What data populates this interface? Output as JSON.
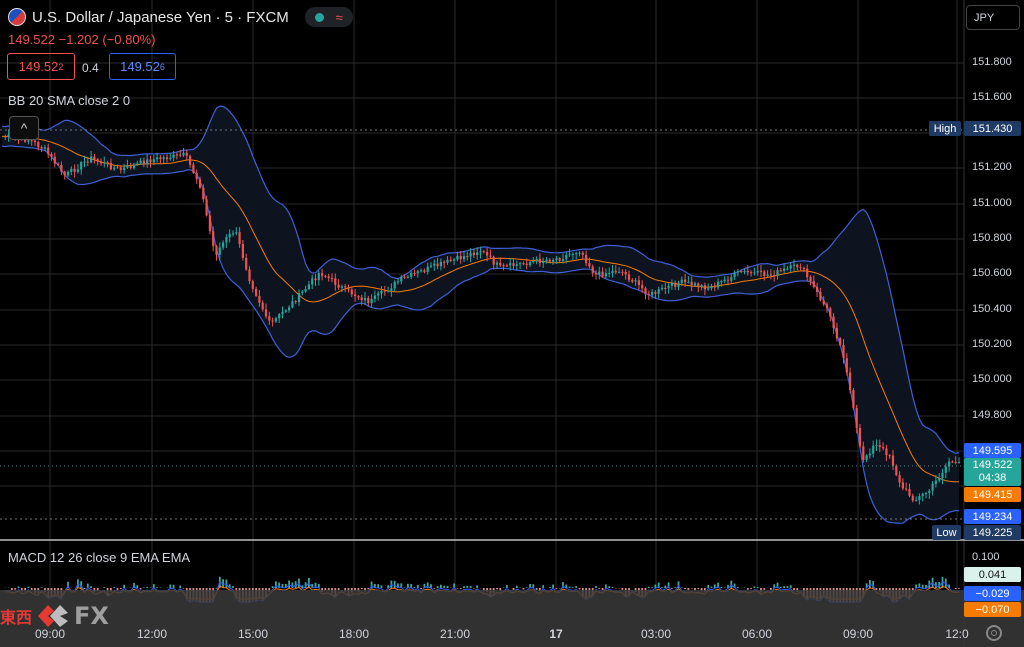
{
  "header": {
    "symbol": "U.S. Dollar / Japanese Yen · 5 · FXCM",
    "wave_icon": "≈"
  },
  "quote": {
    "last": "149.522",
    "change": "−1.202",
    "change_pct": "(−0.80%)",
    "sell": "149.52",
    "sell_sup": "2",
    "spread": "0.4",
    "buy": "149.52",
    "buy_sup": "6"
  },
  "indicators": {
    "bb_label": "BB 20 SMA close 2 0",
    "macd_label": "MACD 12 26 close 9 EMA EMA"
  },
  "toolbar": {
    "currency": "JPY",
    "collapse_icon": "^"
  },
  "price_axis": {
    "labels": [
      "151.800",
      "151.600",
      "151.400",
      "151.200",
      "151.000",
      "150.800",
      "150.600",
      "150.400",
      "150.200",
      "150.000",
      "149.800",
      "149.600"
    ]
  },
  "price_tags": {
    "high_label": "High",
    "high_value": "151.430",
    "upper_band": "149.595",
    "last": "149.522",
    "countdown": "04:38",
    "mid_band": "149.415",
    "lower_band": "149.234",
    "low_label": "Low",
    "low_value": "149.225"
  },
  "macd_axis": {
    "top": "0.100",
    "hist": "0.041",
    "macd": "−0.029",
    "signal": "−0.070"
  },
  "time_axis": [
    "09:00",
    "12:00",
    "15:00",
    "18:00",
    "21:00",
    "17",
    "03:00",
    "06:00",
    "09:00",
    "12:0"
  ],
  "logo": {
    "cn": "東西",
    "fx": "FX"
  },
  "colors": {
    "bull": "#26a69a",
    "bear": "#ef5350",
    "band": "#3f5fd6",
    "basis": "#f57c00",
    "bg": "#000000"
  },
  "chart_data": {
    "type": "line",
    "title": "U.S. Dollar / Japanese Yen · 5 · FXCM",
    "x": [
      "09:00",
      "12:00",
      "15:00",
      "18:00",
      "21:00",
      "17",
      "03:00",
      "06:00",
      "09:00",
      "12:0"
    ],
    "ylim": [
      149.2,
      151.9
    ],
    "series": [
      {
        "name": "",
        "values": [
          151.38,
          151.22,
          150.4,
          150.62,
          150.75,
          150.68,
          150.52,
          150.63,
          149.6,
          149.52
        ]
      }
    ]
  }
}
